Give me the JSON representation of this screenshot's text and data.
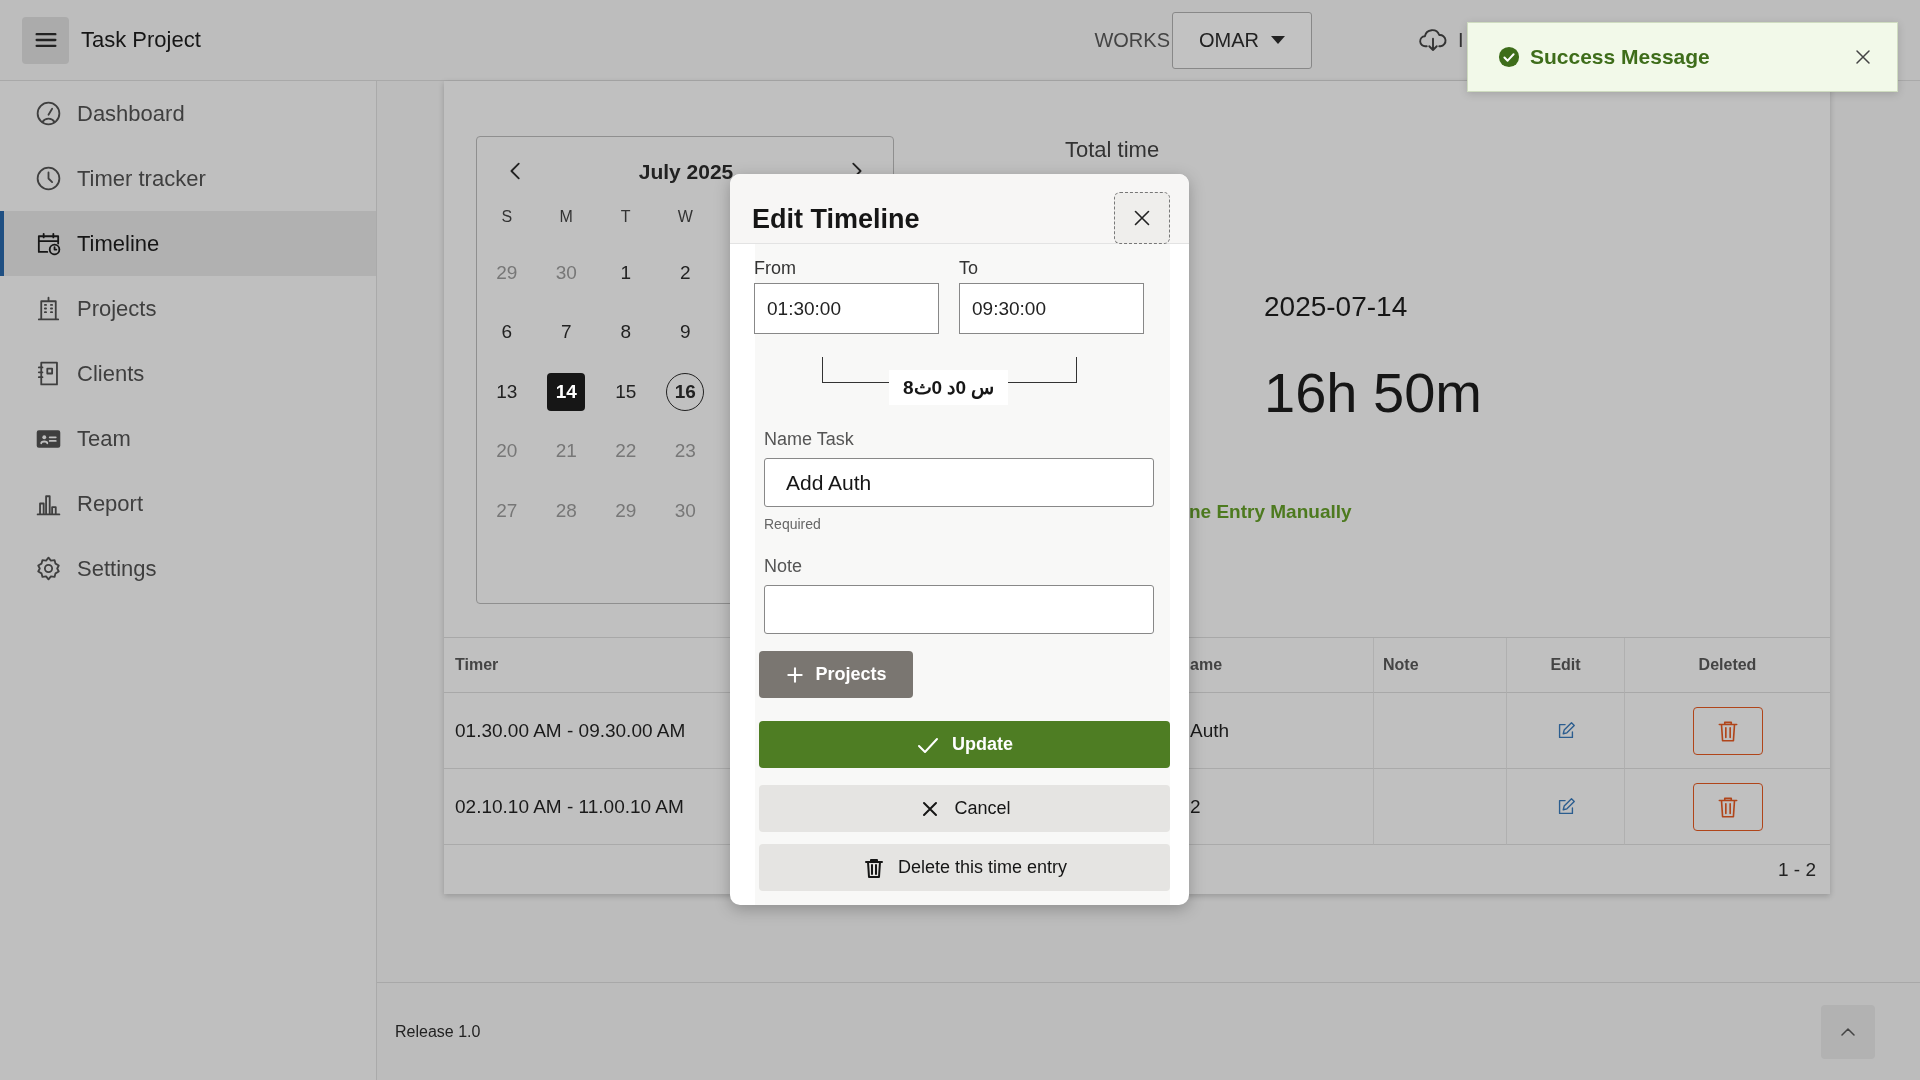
{
  "header": {
    "title": "Task Project",
    "workspace_label": "WORKS",
    "user_menu": "OMAR",
    "cut_text": "I"
  },
  "toast": {
    "message": "Success Message"
  },
  "sidebar": {
    "items": [
      {
        "label": "Dashboard",
        "selected": false
      },
      {
        "label": "Timer tracker",
        "selected": false
      },
      {
        "label": "Timeline",
        "selected": true
      },
      {
        "label": "Projects",
        "selected": false
      },
      {
        "label": "Clients",
        "selected": false
      },
      {
        "label": "Team",
        "selected": false
      },
      {
        "label": "Report",
        "selected": false
      },
      {
        "label": "Settings",
        "selected": false
      }
    ]
  },
  "calendar": {
    "title": "July 2025",
    "weekdays": [
      "S",
      "M",
      "T",
      "W"
    ],
    "weeks": [
      [
        {
          "label": "29",
          "muted": true,
          "selected": false,
          "today": false
        },
        {
          "label": "30",
          "muted": true,
          "selected": false,
          "today": false
        },
        {
          "label": "1",
          "muted": false,
          "selected": false,
          "today": false
        },
        {
          "label": "2",
          "muted": false,
          "selected": false,
          "today": false
        }
      ],
      [
        {
          "label": "6",
          "muted": false,
          "selected": false,
          "today": false
        },
        {
          "label": "7",
          "muted": false,
          "selected": false,
          "today": false
        },
        {
          "label": "8",
          "muted": false,
          "selected": false,
          "today": false
        },
        {
          "label": "9",
          "muted": false,
          "selected": false,
          "today": false
        }
      ],
      [
        {
          "label": "13",
          "muted": false,
          "selected": false,
          "today": false
        },
        {
          "label": "14",
          "muted": false,
          "selected": true,
          "today": false
        },
        {
          "label": "15",
          "muted": false,
          "selected": false,
          "today": false
        },
        {
          "label": "16",
          "muted": false,
          "selected": false,
          "today": true
        }
      ],
      [
        {
          "label": "20",
          "muted": true,
          "selected": false,
          "today": false
        },
        {
          "label": "21",
          "muted": true,
          "selected": false,
          "today": false
        },
        {
          "label": "22",
          "muted": true,
          "selected": false,
          "today": false
        },
        {
          "label": "23",
          "muted": true,
          "selected": false,
          "today": false
        }
      ],
      [
        {
          "label": "27",
          "muted": true,
          "selected": false,
          "today": false
        },
        {
          "label": "28",
          "muted": true,
          "selected": false,
          "today": false
        },
        {
          "label": "29",
          "muted": true,
          "selected": false,
          "today": false
        },
        {
          "label": "30",
          "muted": true,
          "selected": false,
          "today": false
        }
      ]
    ]
  },
  "summary": {
    "title": "Total time",
    "date": "2025-07-14",
    "total": "16h 50m",
    "link": "ne Entry Manually"
  },
  "table": {
    "columns": [
      "Timer",
      "ame",
      "Note",
      "Edit",
      "Deleted"
    ],
    "rows": [
      {
        "timer": "01.30.00 AM - 09.30.00 AM",
        "name": "Auth"
      },
      {
        "timer": "02.10.10 AM - 11.00.10 AM",
        "name": "2"
      }
    ],
    "pagination": "1 - 2"
  },
  "dialog": {
    "title": "Edit Timeline",
    "from": {
      "label": "From",
      "value": "01:30:00"
    },
    "to": {
      "label": "To",
      "value": "09:30:00"
    },
    "duration": "س 0د 0ث8",
    "name_task": {
      "label": "Name Task",
      "value": "Add Auth",
      "hint": "Required"
    },
    "note": {
      "label": "Note"
    },
    "buttons": {
      "projects": "Projects",
      "update": "Update",
      "cancel": "Cancel",
      "delete": "Delete this time entry"
    }
  },
  "footer": {
    "release": "Release 1.0"
  }
}
